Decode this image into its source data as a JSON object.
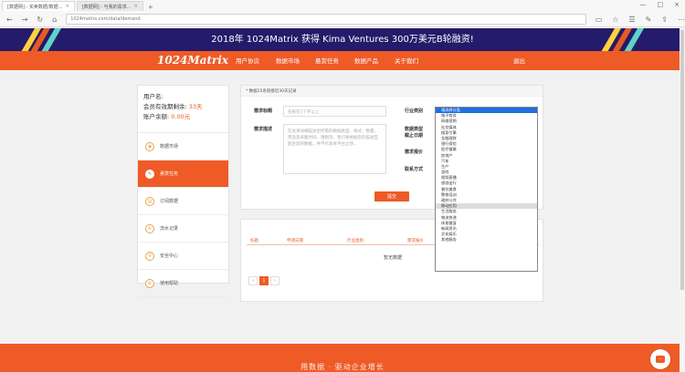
{
  "browser": {
    "tabs": [
      {
        "label": "[数据网] - 买卖数据/数据…",
        "close": "×"
      },
      {
        "label": "[数据网] - 与我的需求…",
        "close": "×"
      }
    ],
    "new_tab": "+",
    "url": "1024matrix.com/data/demand",
    "controls": [
      "—",
      "□",
      "×"
    ]
  },
  "promo": {
    "text": "2018年 1024Matrix 获得 Kima Ventures 300万美元B轮融资!"
  },
  "nav": {
    "logo": "1024Matrix",
    "items": [
      "用户协议",
      "数据市场",
      "悬赏任务",
      "数据产品",
      "关于我们"
    ],
    "logout": "退出"
  },
  "sidebar": {
    "username_label": "用户名:",
    "validity_label": "会员有效期剩余: ",
    "validity_value": "33天",
    "balance_label": "账户余额: ",
    "balance_value": "0.00元",
    "items": [
      {
        "icon": "◉",
        "label": "数据市场"
      },
      {
        "icon": "✎",
        "label": "悬赏任务"
      },
      {
        "icon": "▤",
        "label": "订阅数据"
      },
      {
        "icon": "≡",
        "label": "流水记录"
      },
      {
        "icon": "⛨",
        "label": "安全中心"
      },
      {
        "icon": "⚙",
        "label": "使用帮助"
      }
    ]
  },
  "form": {
    "notice": "* 数据15条链接近30天记录",
    "title_label": "需求标题",
    "title_placeholder": "名称在5个字以上",
    "desc_label": "需求描述",
    "desc_placeholder": "在此请详细描述您所需的数据类型、格式、数量、用途及采集时间、限制等，我们将根据您的描述匹配合适的数据，并不代表本平台立场…",
    "industry_label": "行业类别",
    "data_type_label": "数据类型",
    "deadline_label": "截止日期",
    "budget_label": "需求报价",
    "contact_label": "联系方式",
    "submit_label": "提交"
  },
  "dropdown": {
    "options": [
      "请选择分类",
      "电子商务",
      "网络营销",
      "社交媒体",
      "搜索引擎",
      "金融理财",
      "银行保险",
      "医疗健康",
      "房地产",
      "汽车",
      "生产",
      "游戏",
      "视频直播",
      "旅游出行",
      "餐饮美食",
      "教育培训",
      "政府公共",
      "移动应用",
      "生活服务",
      "物流快递",
      "体育健身",
      "新闻资讯",
      "文化娱乐",
      "其他服务"
    ],
    "selected_index": 0,
    "hover_index": 17
  },
  "table": {
    "headers": [
      "标题",
      "申请日期",
      "行业类别",
      "需求报价"
    ],
    "empty_text": "暂无数据",
    "pager": [
      "‹",
      "1",
      "›"
    ]
  },
  "footer": {
    "text": "用数据 · 驱动企业增长"
  },
  "chat": {
    "icon": "…"
  }
}
